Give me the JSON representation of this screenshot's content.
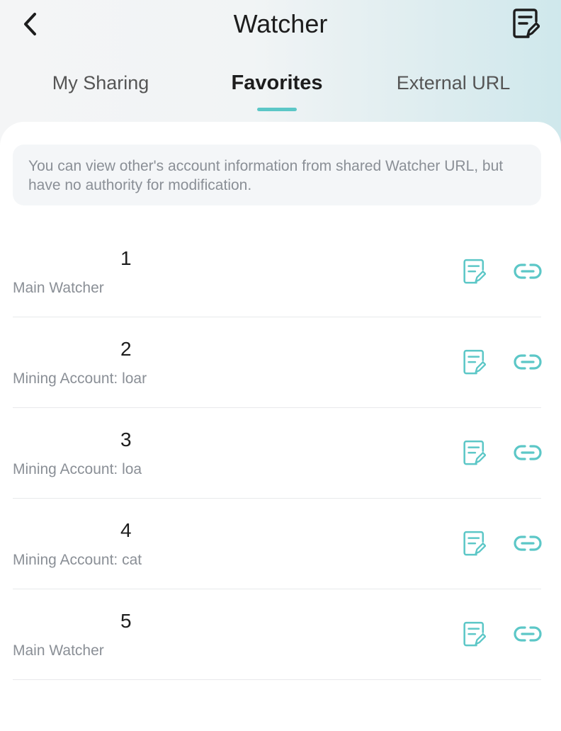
{
  "header": {
    "title": "Watcher",
    "back_icon": "chevron-left-icon",
    "edit_icon": "edit-note-icon"
  },
  "tabs": [
    {
      "label": "My Sharing",
      "active": false
    },
    {
      "label": "Favorites",
      "active": true
    },
    {
      "label": "External URL",
      "active": false
    }
  ],
  "notice": {
    "text": "You can view other's account information from shared Watcher URL, but have no authority for modification."
  },
  "items": [
    {
      "number": "1",
      "subtitle": "Main Watcher"
    },
    {
      "number": "2",
      "subtitle": "Mining Account: loar"
    },
    {
      "number": "3",
      "subtitle": "Mining Account: loa"
    },
    {
      "number": "4",
      "subtitle": "Mining Account: cat"
    },
    {
      "number": "5",
      "subtitle": "Main Watcher"
    }
  ],
  "icons": {
    "row_edit": "edit-note-icon",
    "row_link": "link-icon"
  },
  "colors": {
    "accent": "#5cc7c7",
    "title": "#1d1d1d",
    "secondary_text": "#8a8f96"
  }
}
